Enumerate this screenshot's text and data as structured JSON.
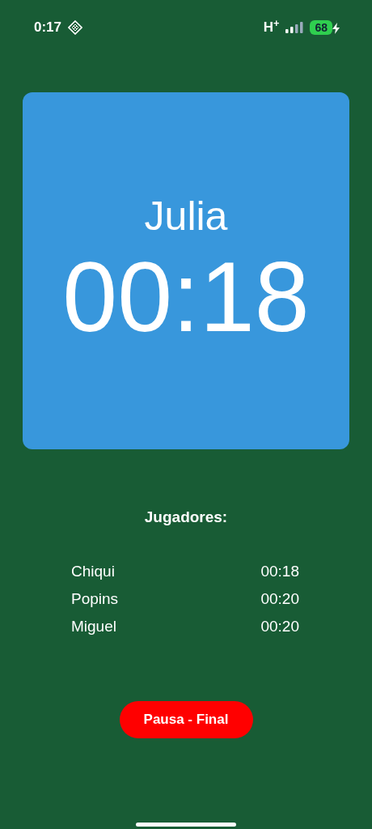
{
  "status_bar": {
    "time": "0:17",
    "network": "H$^{+}$",
    "battery": "68",
    "charging": true
  },
  "current": {
    "name": "Julia",
    "time": "00:18"
  },
  "players_title": "Jugadores:",
  "players": [
    {
      "name": "Chiqui",
      "time": "00:18"
    },
    {
      "name": "Popins",
      "time": "00:20"
    },
    {
      "name": "Miguel",
      "time": "00:20"
    }
  ],
  "button": "Pausa - Final"
}
